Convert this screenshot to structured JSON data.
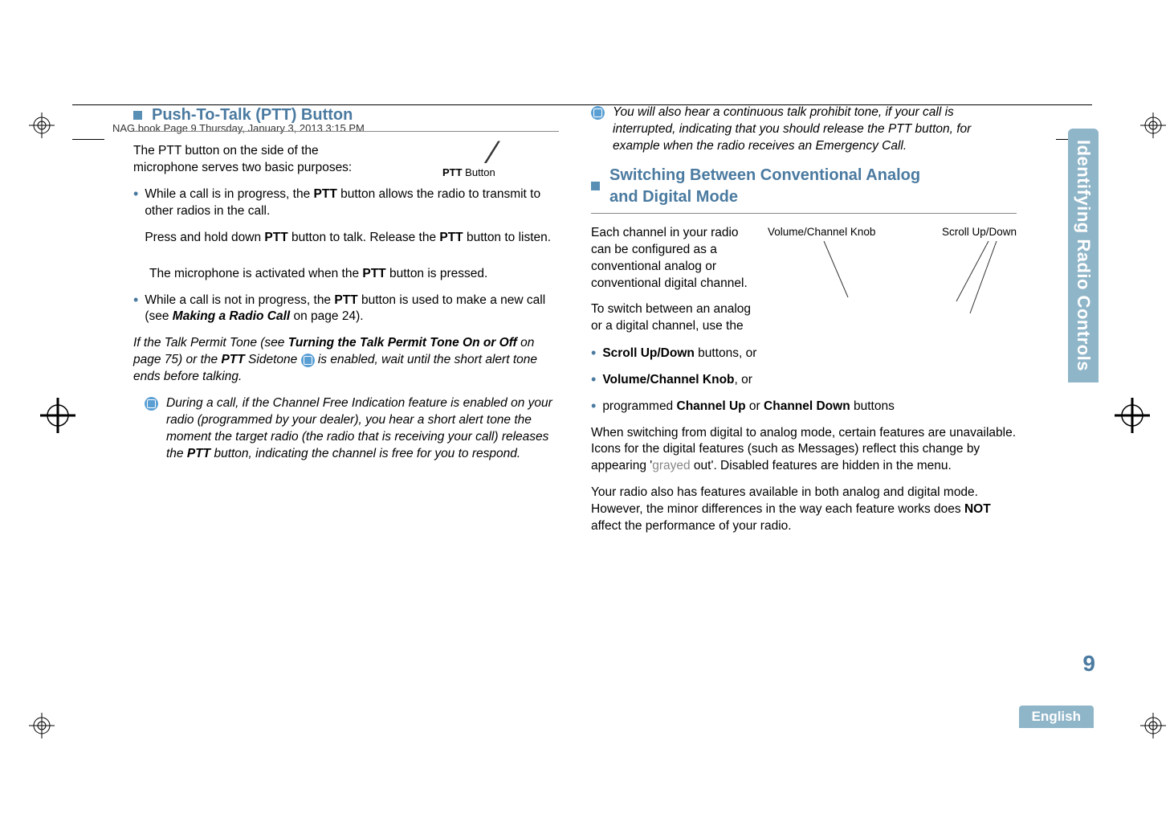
{
  "header": {
    "running_head": "NAG.book  Page 9  Thursday, January 3, 2013  3:15 PM"
  },
  "left": {
    "title": "Push-To-Talk (PTT) Button",
    "intro": "The PTT button on the side of the microphone serves two basic purposes:",
    "figure_caption_prefix": "PTT",
    "figure_caption_suffix": " Button",
    "b1_a": "While a call is in progress, the ",
    "b1_b": "PTT",
    "b1_c": " button allows the radio to transmit to other radios in the call.",
    "b1_p2_a": "Press and hold down ",
    "b1_p2_b": "PTT",
    "b1_p2_c": " button to talk. Release the ",
    "b1_p2_d": "PTT",
    "b1_p2_e": " button to listen.",
    "mic_a": "The microphone is activated when the ",
    "mic_b": "PTT",
    "mic_c": " button is pressed.",
    "b2_a": "While a call is not in progress, the ",
    "b2_b": "PTT",
    "b2_c": " button is used to make a new call (see ",
    "b2_d": "Making a Radio Call",
    "b2_e": " on page 24).",
    "tone_a": "If the Talk Permit Tone (see ",
    "tone_b": "Turning the Talk Permit Tone On or Off",
    "tone_c": " on page 75) or the ",
    "tone_d": "PTT",
    "tone_e": " Sidetone ",
    "tone_f": " is enabled, wait until the short alert tone ends before talking.",
    "note1_a": "During a call, if the Channel Free Indication feature is enabled on your radio (programmed by your dealer), you hear a short alert tone the moment the target radio (the radio that is receiving your call) releases the ",
    "note1_b": "PTT",
    "note1_c": " button, indicating the channel is free for you to respond."
  },
  "right": {
    "note2": "You will also hear a continuous talk prohibit tone, if your call is interrupted, indicating that you should release the PTT button, for example when the radio receives an Emergency Call.",
    "title_l1": "Switching Between Conventional Analog",
    "title_l2": "and Digital Mode",
    "fig_label1": "Volume/Channel Knob",
    "fig_label2": "Scroll Up/Down",
    "para1": "Each channel in your radio can be configured as a conventional analog or conventional digital channel.",
    "para2": "To switch between an analog or a digital channel, use the",
    "li1_a": "Scroll Up/Down",
    "li1_b": " buttons, or",
    "li2_a": "Volume/Channel Knob",
    "li2_b": ", or",
    "li3_a": "programmed ",
    "li3_b": "Channel Up",
    "li3_c": " or ",
    "li3_d": "Channel Down",
    "li3_e": " buttons",
    "para3_a": "When switching from digital to analog mode, certain features are unavailable. Icons for the digital features (such as Messages) reflect this change by appearing '",
    "para3_b": "grayed",
    "para3_c": " out'. Disabled features are hidden in the menu.",
    "para4_a": "Your radio also has features available in both analog and digital mode. However, the minor differences in the way each feature works does ",
    "para4_b": "NOT",
    "para4_c": " affect the performance of your radio."
  },
  "chrome": {
    "side_tab": "Identifying Radio Controls",
    "page_number": "9",
    "language": "English"
  }
}
